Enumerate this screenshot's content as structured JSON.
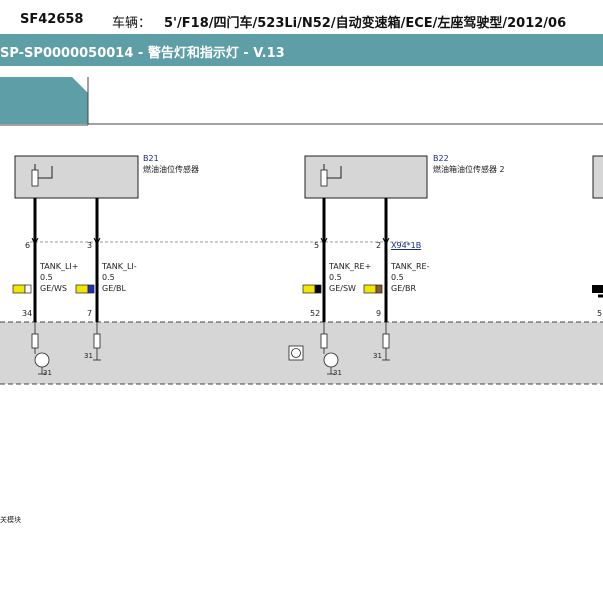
{
  "header": {
    "order_no": "SF42658",
    "vehicle_label": "车辆：",
    "vehicle": "5'/F18/四门车/523Li/N52/自动变速箱/ECE/左座驾驶型/2012/06"
  },
  "title": "SP-SP0000050014 - 警告灯和指示灯 - V.13",
  "components": [
    {
      "id": "B21",
      "name": "燃油油位传感器"
    },
    {
      "id": "B22",
      "name": "燃油箱油位传感器 2"
    }
  ],
  "connector_label": "X94*1B",
  "wires": [
    {
      "pin_top": "6",
      "signal": "TANK_LI+",
      "size": "0.5",
      "color": "GE/WS",
      "swatch": [
        "#f2e600",
        "#ffffff"
      ],
      "pin_bottom": "34"
    },
    {
      "pin_top": "3",
      "signal": "TANK_LI-",
      "size": "0.5",
      "color": "GE/BL",
      "swatch": [
        "#f2e600",
        "#1c2fc4"
      ],
      "pin_bottom": "7"
    },
    {
      "pin_top": "5",
      "signal": "TANK_RE+",
      "size": "0.5",
      "color": "GE/SW",
      "swatch": [
        "#f2e600",
        "#000000"
      ],
      "pin_bottom": "52"
    },
    {
      "pin_top": "2",
      "signal": "TANK_RE-",
      "size": "0.5",
      "color": "GE/BR",
      "swatch": [
        "#f2e600",
        "#8a5a2b"
      ],
      "pin_bottom": "9"
    }
  ],
  "ground_labels": [
    "31",
    "31",
    "31",
    "31"
  ],
  "edge_pin": "5",
  "footer_text": "关模块",
  "colors": {
    "title_bg": "#5e9ea6",
    "module_bg": "#d6d6d6",
    "box_bg": "#d6d6d6",
    "link_blue": "#1a2a8c"
  }
}
